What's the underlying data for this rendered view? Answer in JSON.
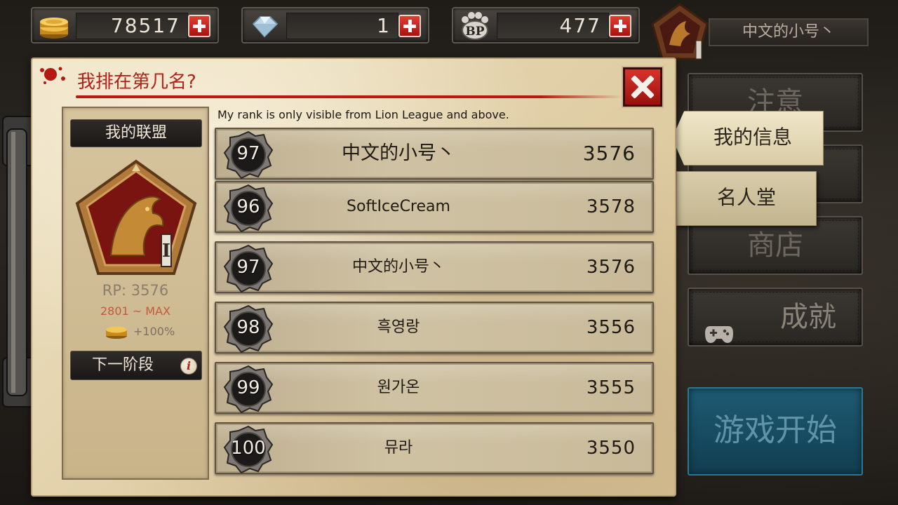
{
  "currencies": {
    "gold": {
      "value": "78517",
      "icon": "gold-coins-icon"
    },
    "gems": {
      "value": "1",
      "icon": "diamond-icon"
    },
    "bp": {
      "value": "477",
      "icon": "bp-paw-icon",
      "icon_text": "BP"
    }
  },
  "profile": {
    "name": "中文的小号丶",
    "emblem_tier": "I"
  },
  "side_menu": {
    "notice": "注意",
    "hidden_item": "",
    "shop": "商店",
    "achievements": "成就",
    "start_game": "游戏开始"
  },
  "tabs": {
    "my_info": "我的信息",
    "hall_of_fame": "名人堂"
  },
  "panel": {
    "title": "我排在第几名?",
    "note": "My rank is only visible from Lion League and above.",
    "alliance": {
      "header": "我的联盟",
      "tier": "I",
      "rp": "RP: 3576",
      "range": "2801 ~ MAX",
      "bonus": "+100%",
      "next_stage": "下一阶段",
      "info_glyph": "i"
    },
    "rows": [
      {
        "rank": "97",
        "name": "中文的小号丶",
        "score": "3576"
      },
      {
        "rank": "96",
        "name": "SoftIceCream",
        "score": "3578"
      },
      {
        "rank": "97",
        "name": "中文的小号丶",
        "score": "3576"
      },
      {
        "rank": "98",
        "name": "흑영랑",
        "score": "3556"
      },
      {
        "rank": "99",
        "name": "원가온",
        "score": "3555"
      },
      {
        "rank": "100",
        "name": "뮤라",
        "score": "3550"
      }
    ]
  },
  "colors": {
    "accent_red": "#b0221b",
    "start_blue": "#1e5a72",
    "parchment": "#e2d1aa"
  }
}
